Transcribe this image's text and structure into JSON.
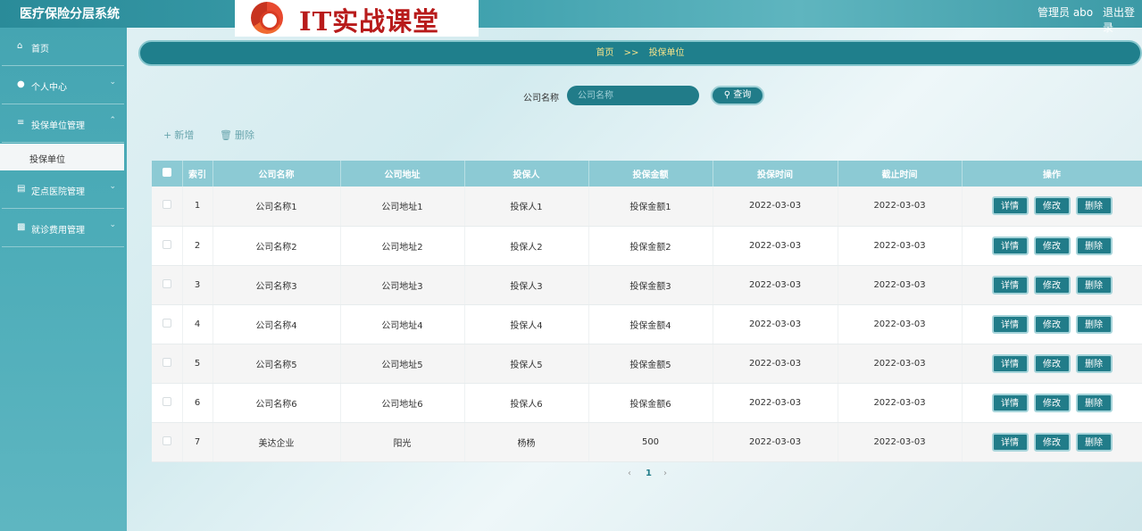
{
  "header": {
    "app_title": "医疗保险分层系统",
    "logo_text": "IT实战课堂",
    "user_label": "管理员 abo",
    "logout_label": "退出登录"
  },
  "sidebar": {
    "items": [
      {
        "label": "首页",
        "icon": "home-icon"
      },
      {
        "label": "个人中心",
        "icon": "user-icon"
      },
      {
        "label": "投保单位管理",
        "icon": "list-icon"
      },
      {
        "label": "定点医院管理",
        "icon": "clipboard-icon"
      },
      {
        "label": "就诊费用管理",
        "icon": "document-icon"
      }
    ],
    "active_sub": "投保单位"
  },
  "breadcrumb": {
    "home": "首页",
    "sep": ">>",
    "current": "投保单位"
  },
  "search": {
    "label": "公司名称",
    "placeholder": "公司名称",
    "button": "查询"
  },
  "toolbar": {
    "add": "新增",
    "delete": "删除"
  },
  "table": {
    "columns": [
      "索引",
      "公司名称",
      "公司地址",
      "投保人",
      "投保金额",
      "投保时间",
      "截止时间",
      "操作"
    ],
    "rows": [
      {
        "index": "1",
        "company": "公司名称1",
        "address": "公司地址1",
        "insurer": "投保人1",
        "amount": "投保金额1",
        "start": "2022-03-03",
        "end": "2022-03-03"
      },
      {
        "index": "2",
        "company": "公司名称2",
        "address": "公司地址2",
        "insurer": "投保人2",
        "amount": "投保金额2",
        "start": "2022-03-03",
        "end": "2022-03-03"
      },
      {
        "index": "3",
        "company": "公司名称3",
        "address": "公司地址3",
        "insurer": "投保人3",
        "amount": "投保金额3",
        "start": "2022-03-03",
        "end": "2022-03-03"
      },
      {
        "index": "4",
        "company": "公司名称4",
        "address": "公司地址4",
        "insurer": "投保人4",
        "amount": "投保金额4",
        "start": "2022-03-03",
        "end": "2022-03-03"
      },
      {
        "index": "5",
        "company": "公司名称5",
        "address": "公司地址5",
        "insurer": "投保人5",
        "amount": "投保金额5",
        "start": "2022-03-03",
        "end": "2022-03-03"
      },
      {
        "index": "6",
        "company": "公司名称6",
        "address": "公司地址6",
        "insurer": "投保人6",
        "amount": "投保金额6",
        "start": "2022-03-03",
        "end": "2022-03-03"
      },
      {
        "index": "7",
        "company": "美达企业",
        "address": "阳光",
        "insurer": "杨杨",
        "amount": "500",
        "start": "2022-03-03",
        "end": "2022-03-03"
      }
    ],
    "actions": {
      "detail": "详情",
      "edit": "修改",
      "delete": "删除"
    }
  },
  "pager": {
    "prev": "‹",
    "current": "1",
    "next": "›"
  },
  "colors": {
    "primary": "#217c89",
    "header_cell": "#8ccad4",
    "breadcrumb_text": "#f4e38a"
  }
}
